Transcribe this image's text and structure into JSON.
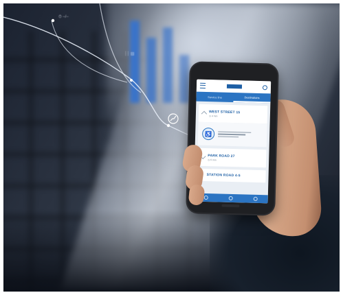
{
  "photo": {
    "subject": "hand holding a smartphone with a transit app",
    "accent_color": "#2b74c2"
  },
  "app": {
    "tabs": [
      {
        "label": "Service line"
      },
      {
        "label": "Destinations",
        "active": true
      }
    ],
    "stops": [
      {
        "title": "WEST STREET 15",
        "sub": "◷ 4 min",
        "expanded": true
      },
      {
        "title": "PARK ROAD 27",
        "sub": "◷ 6 min",
        "expanded": false
      },
      {
        "title": "STATION ROAD 4-5",
        "sub": "",
        "expanded": false
      }
    ],
    "icons": [
      "menu-icon",
      "logo-icon",
      "search-icon",
      "escalator-icon"
    ]
  },
  "overlay": {
    "labels": [
      {
        "text": "⏱ –/–"
      },
      {
        "text": "┆┆ ▤"
      }
    ]
  }
}
